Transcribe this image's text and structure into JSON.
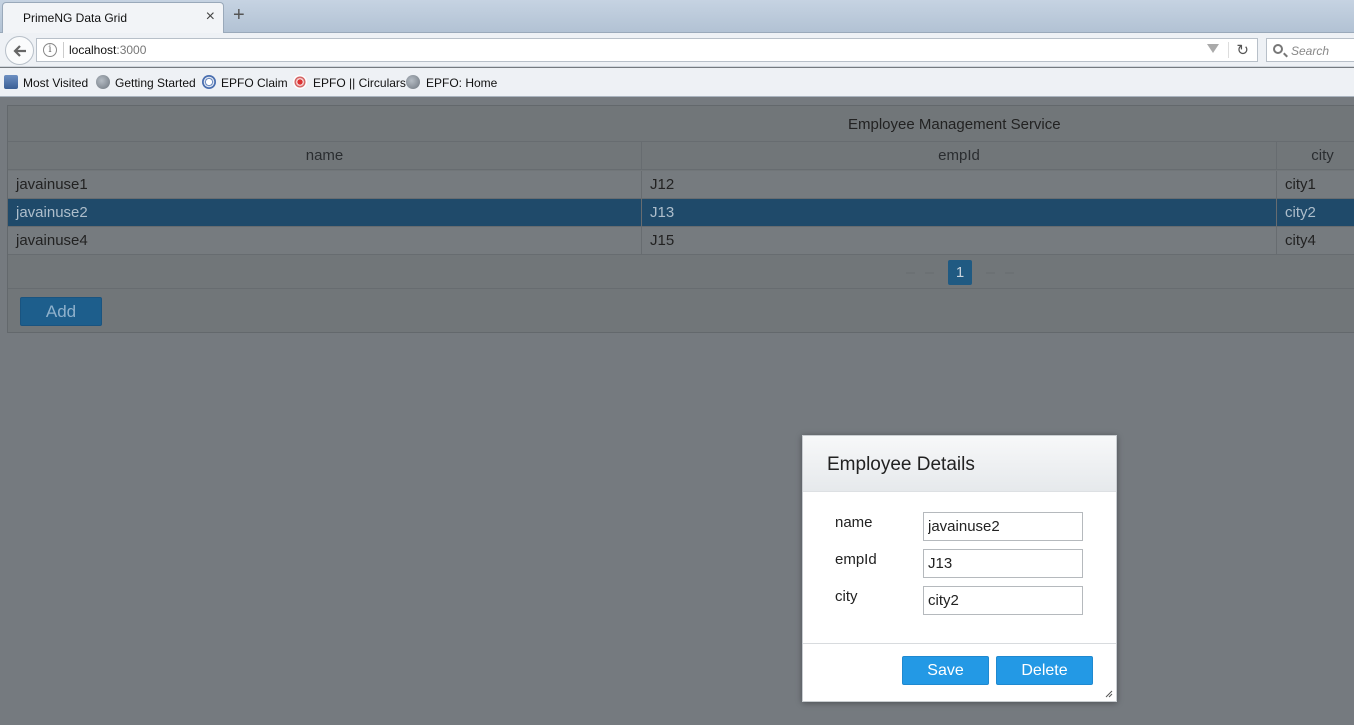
{
  "browser": {
    "tab_title": "PrimeNG Data Grid",
    "tab_close": "×",
    "new_tab": "+",
    "url_host": "localhost",
    "url_port": ":3000",
    "search_placeholder": "Search",
    "bookmarks": [
      {
        "label": "Most Visited",
        "icon": "bookmark-folder-icon"
      },
      {
        "label": "Getting Started",
        "icon": "globe-icon"
      },
      {
        "label": "EPFO Claim",
        "icon": "seal-icon"
      },
      {
        "label": "EPFO || Circulars",
        "icon": "seal-icon"
      },
      {
        "label": "EPFO: Home",
        "icon": "globe-icon"
      }
    ]
  },
  "grid": {
    "caption": "Employee Management Service",
    "columns": [
      "name",
      "empId",
      "city"
    ],
    "rows": [
      {
        "name": "javainuse1",
        "empId": "J12",
        "city": "city1"
      },
      {
        "name": "javainuse2",
        "empId": "J13",
        "city": "city2"
      },
      {
        "name": "javainuse4",
        "empId": "J15",
        "city": "city4"
      }
    ],
    "selected_row": 1,
    "page": "1",
    "add_label": "Add"
  },
  "dialog": {
    "title": "Employee Details",
    "fields": [
      {
        "label": "name",
        "value": "javainuse2"
      },
      {
        "label": "empId",
        "value": "J13"
      },
      {
        "label": "city",
        "value": "city2"
      }
    ],
    "save_label": "Save",
    "delete_label": "Delete"
  }
}
